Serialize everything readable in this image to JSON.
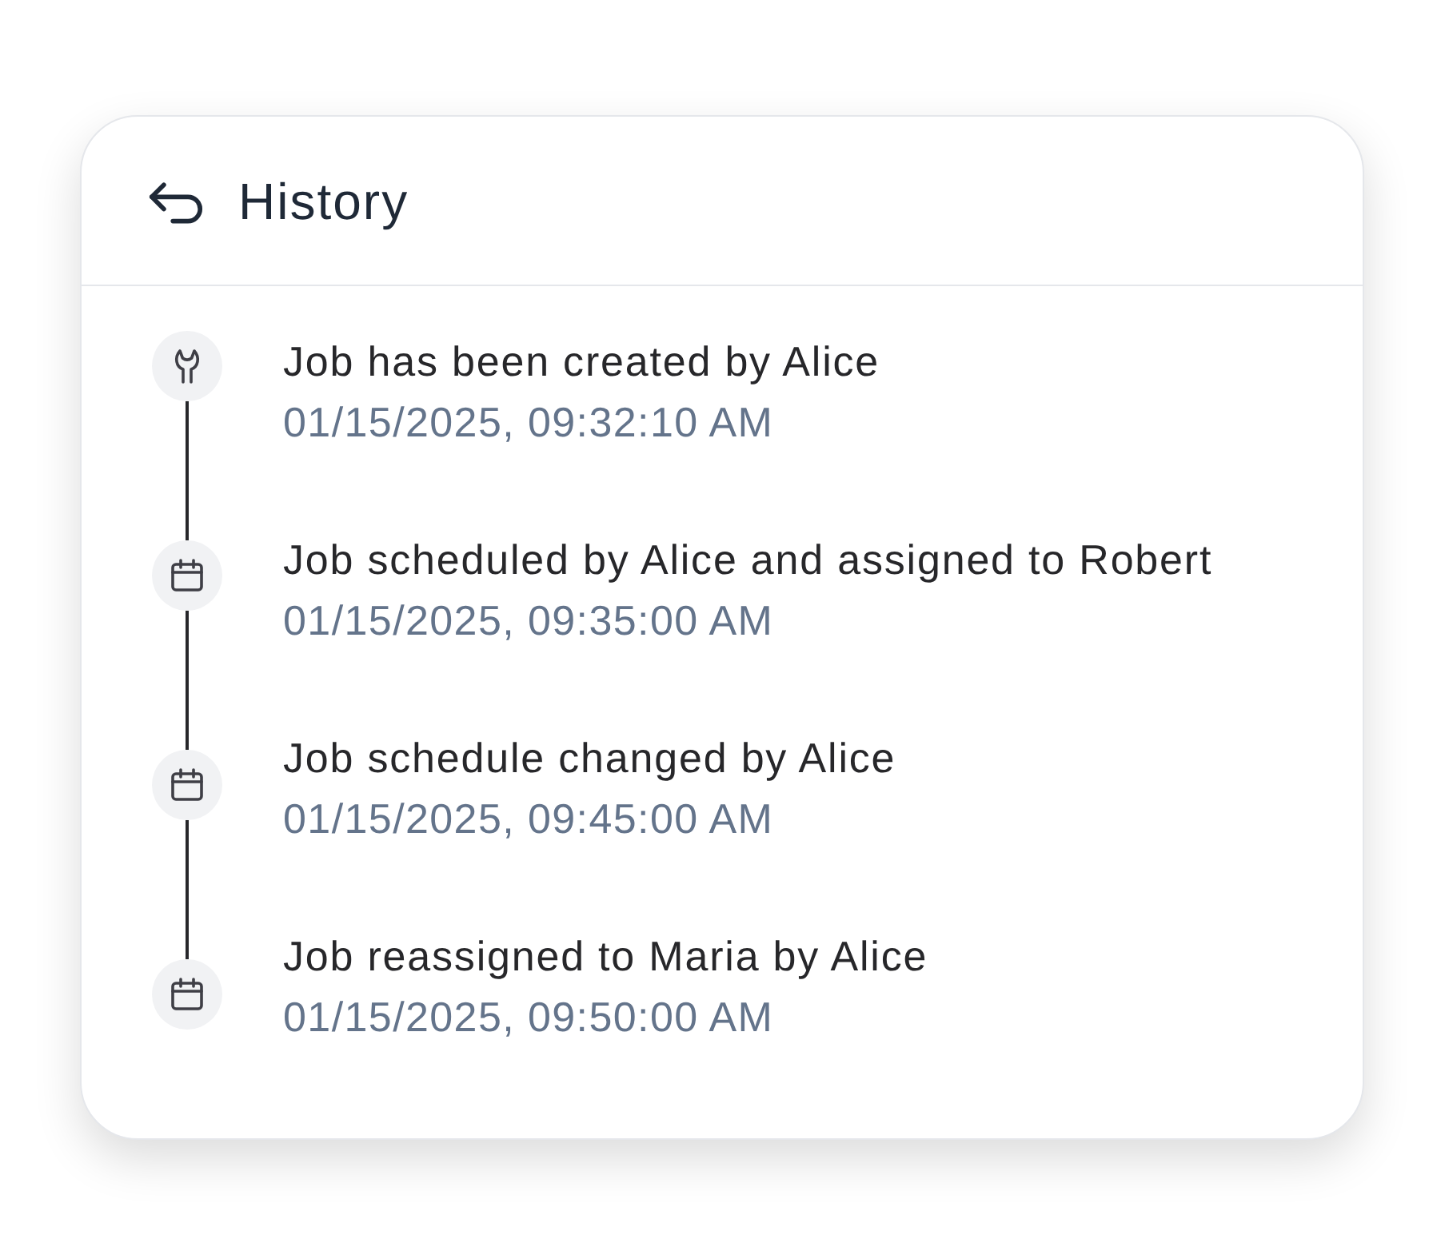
{
  "header": {
    "title": "History"
  },
  "events": [
    {
      "kind": "created",
      "text": "Job has been created by Alice",
      "time": "01/15/2025, 09:32:10 AM"
    },
    {
      "kind": "schedule",
      "text": "Job scheduled by Alice and assigned to Robert",
      "time": "01/15/2025, 09:35:00 AM"
    },
    {
      "kind": "schedule",
      "text": "Job schedule changed by Alice",
      "time": "01/15/2025, 09:45:00 AM"
    },
    {
      "kind": "schedule",
      "text": "Job reassigned to Maria by Alice",
      "time": "01/15/2025, 09:50:00 AM"
    }
  ]
}
